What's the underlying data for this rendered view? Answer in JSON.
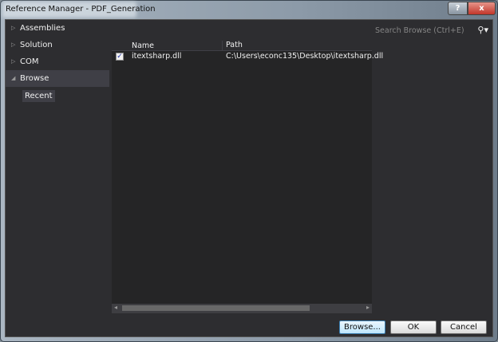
{
  "window": {
    "title": "Reference Manager - PDF_Generation",
    "help": "?",
    "close": "x"
  },
  "sidebar": {
    "items": [
      {
        "label": "Assemblies",
        "arrow": "▷"
      },
      {
        "label": "Solution",
        "arrow": "▷"
      },
      {
        "label": "COM",
        "arrow": "▷"
      },
      {
        "label": "Browse",
        "arrow": "◢"
      }
    ],
    "recent": "Recent"
  },
  "search": {
    "placeholder": "Search Browse (Ctrl+E)",
    "icon": "⚲▾"
  },
  "table": {
    "columns": [
      "Name",
      "Path"
    ],
    "rows": [
      {
        "checked": true,
        "check": "✓",
        "name": "itextsharp.dll",
        "path": "C:\\Users\\econc135\\Desktop\\itextsharp.dll"
      }
    ]
  },
  "buttons": {
    "browse": "Browse...",
    "ok": "OK",
    "cancel": "Cancel"
  }
}
